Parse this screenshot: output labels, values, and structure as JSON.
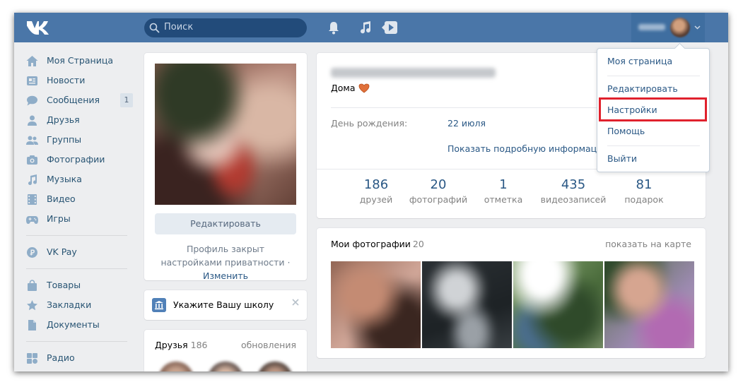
{
  "header": {
    "search_placeholder": "Поиск"
  },
  "user_menu": {
    "items": [
      "Моя страница",
      "Редактировать",
      "Настройки",
      "Помощь",
      "Выйти"
    ],
    "highlighted": "Настройки"
  },
  "nav": {
    "items": [
      {
        "label": "Моя Страница",
        "icon": "home-icon"
      },
      {
        "label": "Новости",
        "icon": "news-icon"
      },
      {
        "label": "Сообщения",
        "icon": "messages-icon",
        "badge": "1"
      },
      {
        "label": "Друзья",
        "icon": "friends-icon"
      },
      {
        "label": "Группы",
        "icon": "groups-icon"
      },
      {
        "label": "Фотографии",
        "icon": "camera-icon"
      },
      {
        "label": "Музыка",
        "icon": "music-icon"
      },
      {
        "label": "Видео",
        "icon": "video-icon"
      },
      {
        "label": "Игры",
        "icon": "gamepad-icon"
      },
      {
        "label": "VK Pay",
        "icon": "vkpay-icon"
      },
      {
        "label": "Товары",
        "icon": "bag-icon"
      },
      {
        "label": "Закладки",
        "icon": "star-icon"
      },
      {
        "label": "Документы",
        "icon": "document-icon"
      },
      {
        "label": "Радио",
        "icon": "radio-icon"
      }
    ]
  },
  "profile": {
    "edit_button": "Редактировать",
    "closed_text": "Профиль закрыт настройками приватности",
    "closed_sep": "·",
    "change_link": "Изменить",
    "status": "Дома",
    "birthday_label": "День рождения:",
    "birthday_value": "22 июля",
    "show_more": "Показать подробную информацию",
    "counters": [
      {
        "num": "186",
        "label": "друзей"
      },
      {
        "num": "20",
        "label": "фотографий"
      },
      {
        "num": "1",
        "label": "отметка"
      },
      {
        "num": "435",
        "label": "видеозаписей"
      },
      {
        "num": "81",
        "label": "подарок"
      }
    ]
  },
  "school": {
    "label": "Укажите Вашу школу"
  },
  "friends": {
    "title": "Друзья",
    "count": "186",
    "updates": "обновления"
  },
  "photos": {
    "title": "Мои фотографии",
    "count": "20",
    "map_link": "показать на карте"
  },
  "colors": {
    "header": "#4a76a8",
    "link": "#2a5885",
    "highlight_border": "#e0212d"
  }
}
